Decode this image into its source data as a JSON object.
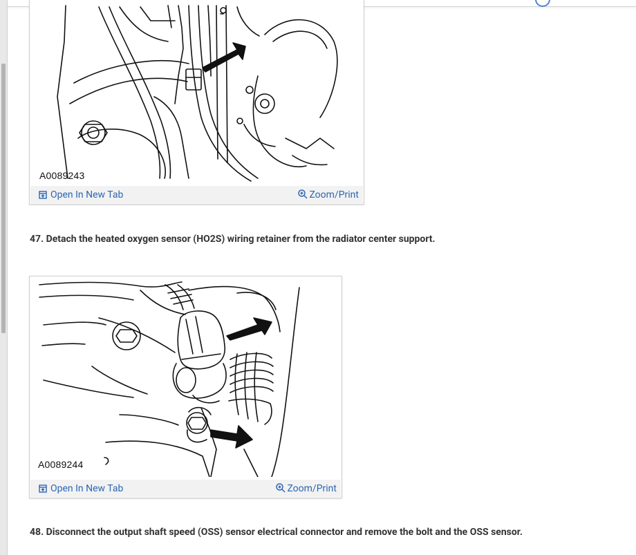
{
  "figures": [
    {
      "id_label": "A0089243",
      "open_tab_label": "Open In New Tab",
      "zoom_label": "Zoom/Print"
    },
    {
      "id_label": "A0089244",
      "open_tab_label": "Open In New Tab",
      "zoom_label": "Zoom/Print"
    }
  ],
  "steps": [
    {
      "number": "47.",
      "text": "47. Detach the heated oxygen sensor (HO2S) wiring retainer from the radiator center support."
    },
    {
      "number": "48.",
      "text": "48. Disconnect the output shaft speed (OSS) sensor electrical connector and remove the bolt and the OSS sensor."
    }
  ],
  "icons": {
    "open_tab": "open-in-new-tab-icon",
    "zoom": "zoom-in-icon"
  },
  "colors": {
    "link": "#2c66b2",
    "step_text": "#333333",
    "caption_bar": "#f2f2f2"
  }
}
